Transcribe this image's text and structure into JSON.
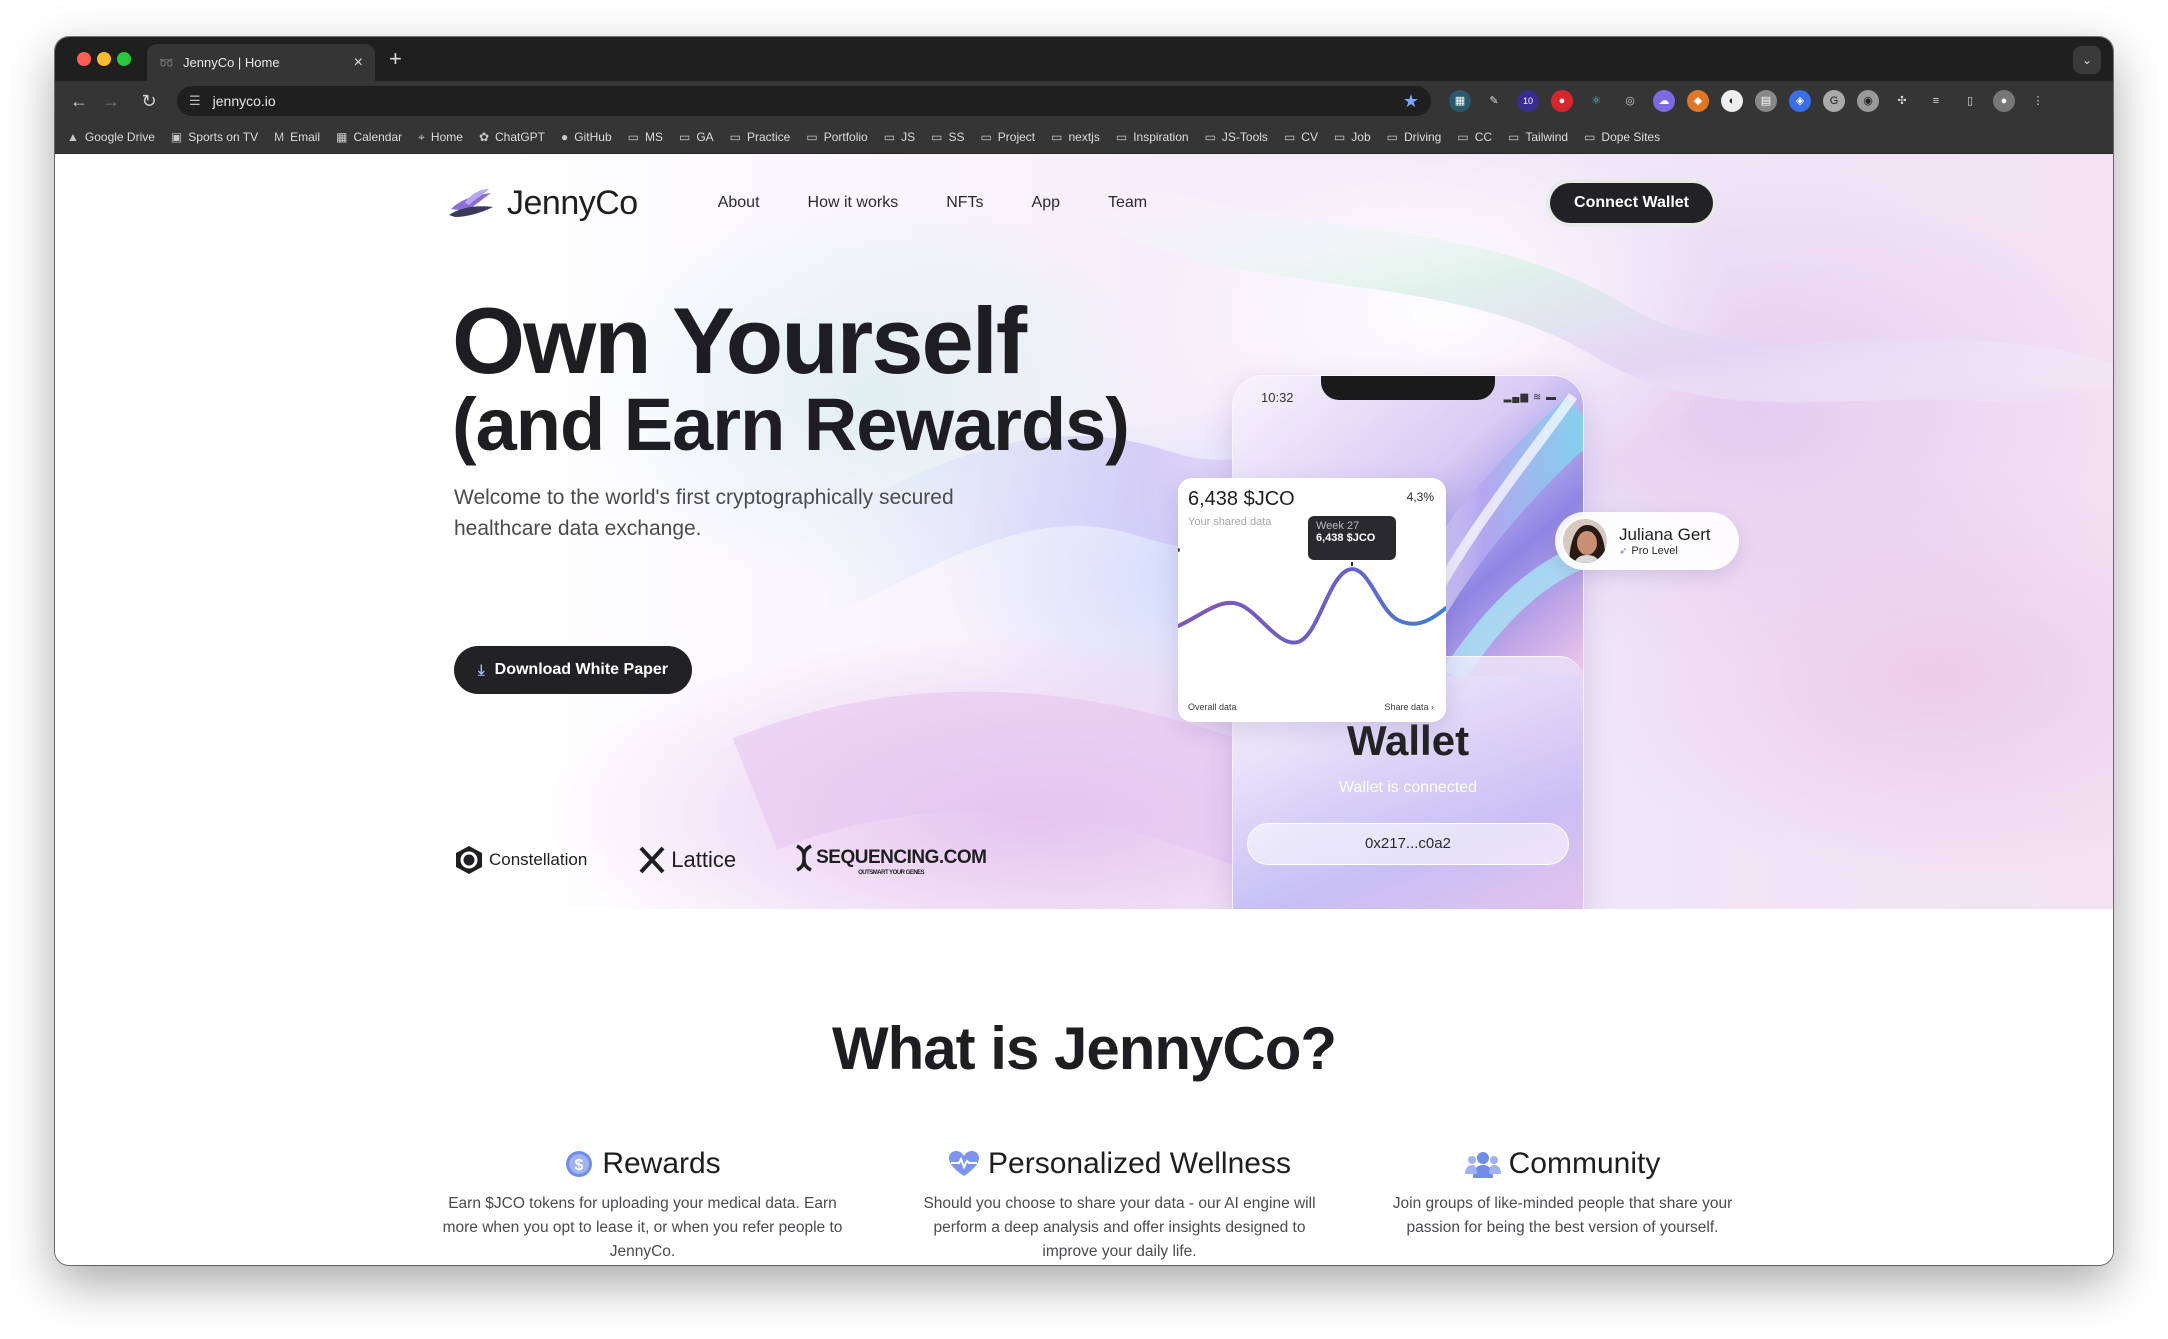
{
  "browser": {
    "tab_title": "JennyCo | Home",
    "url": "jennyco.io",
    "bookmarks": [
      {
        "label": "Google Drive",
        "icon": "drive-icon"
      },
      {
        "label": "Sports on TV",
        "icon": "tv-icon"
      },
      {
        "label": "Email",
        "icon": "gmail-icon"
      },
      {
        "label": "Calendar",
        "icon": "calendar-icon"
      },
      {
        "label": "Home",
        "icon": "map-pin-icon"
      },
      {
        "label": "ChatGPT",
        "icon": "chatgpt-icon"
      },
      {
        "label": "GitHub",
        "icon": "github-icon"
      },
      {
        "label": "MS",
        "icon": "folder-icon"
      },
      {
        "label": "GA",
        "icon": "folder-icon"
      },
      {
        "label": "Practice",
        "icon": "folder-icon"
      },
      {
        "label": "Portfolio",
        "icon": "folder-icon"
      },
      {
        "label": "JS",
        "icon": "folder-icon"
      },
      {
        "label": "SS",
        "icon": "folder-icon"
      },
      {
        "label": "Project",
        "icon": "folder-icon"
      },
      {
        "label": "nextjs",
        "icon": "folder-icon"
      },
      {
        "label": "Inspiration",
        "icon": "folder-icon"
      },
      {
        "label": "JS-Tools",
        "icon": "folder-icon"
      },
      {
        "label": "CV",
        "icon": "folder-icon"
      },
      {
        "label": "Job",
        "icon": "folder-icon"
      },
      {
        "label": "Driving",
        "icon": "folder-icon"
      },
      {
        "label": "CC",
        "icon": "folder-icon"
      },
      {
        "label": "Tailwind",
        "icon": "folder-icon"
      },
      {
        "label": "Dope Sites",
        "icon": "folder-icon"
      }
    ],
    "extension_badge": "10"
  },
  "site": {
    "brand": "JennyCo",
    "nav": [
      "About",
      "How it works",
      "NFTs",
      "App",
      "Team"
    ],
    "connect_label": "Connect Wallet"
  },
  "hero": {
    "title_line1": "Own Yourself",
    "title_line2": "(and Earn Rewards)",
    "subtitle": "Welcome to the world's first cryptographically secured healthcare data exchange.",
    "download_label": "Download White Paper",
    "partners": {
      "constellation": "Constellation",
      "lattice": "Lattice",
      "sequencing": "SEQUENCING.COM",
      "sequencing_tagline": "OUTSMART YOUR GENES"
    }
  },
  "phone": {
    "time": "10:32",
    "wallet_title": "Wallet",
    "wallet_status": "Wallet is connected",
    "wallet_address": "0x217...c0a2"
  },
  "data_card": {
    "value": "6,438 $JCO",
    "label": "Your shared data",
    "change": "4,3%",
    "tooltip_week": "Week 27",
    "tooltip_value": "6,438 $JCO",
    "footer_left": "Overall data",
    "footer_right": "Share data ›"
  },
  "profile": {
    "name": "Juliana Gert",
    "level": "Pro Level"
  },
  "about": {
    "title": "What is JennyCo?",
    "features": [
      {
        "icon": "dollar-coin-icon",
        "title": "Rewards",
        "desc": "Earn $JCO tokens for uploading your medical data. Earn more when you opt to lease it, or when you refer people to JennyCo."
      },
      {
        "icon": "heartbeat-icon",
        "title": "Personalized Wellness",
        "desc": "Should you choose to share your data - our AI engine will perform a deep analysis and offer insights designed to improve your daily life."
      },
      {
        "icon": "people-group-icon",
        "title": "Community",
        "desc": "Join groups of like-minded people that share your passion for being the best version of yourself."
      }
    ]
  },
  "colors": {
    "accent_dark": "#222225",
    "brand_purple": "#8a6fd4",
    "chart_line_start": "#7b58b8",
    "chart_line_end": "#3f7fd9"
  }
}
